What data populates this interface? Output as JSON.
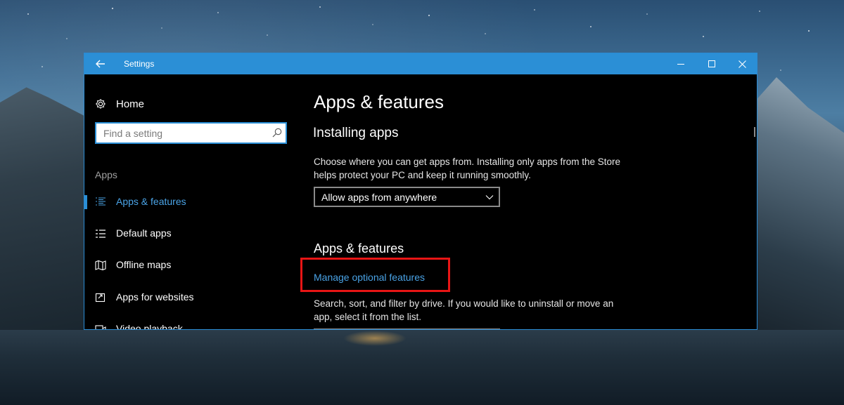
{
  "window": {
    "title": "Settings"
  },
  "sidebar": {
    "home_label": "Home",
    "search_placeholder": "Find a setting",
    "section_label": "Apps",
    "items": [
      {
        "label": "Apps & features",
        "icon": "list-icon",
        "active": true
      },
      {
        "label": "Default apps",
        "icon": "default-apps-icon",
        "active": false
      },
      {
        "label": "Offline maps",
        "icon": "map-icon",
        "active": false
      },
      {
        "label": "Apps for websites",
        "icon": "open-external-icon",
        "active": false
      },
      {
        "label": "Video playback",
        "icon": "video-icon",
        "active": false
      }
    ]
  },
  "main": {
    "page_title": "Apps & features",
    "installing_title": "Installing apps",
    "installing_desc": "Choose where you can get apps from. Installing only apps from the Store helps protect your PC and keep it running smoothly.",
    "install_source_value": "Allow apps from anywhere",
    "apps_title": "Apps & features",
    "manage_link": "Manage optional features",
    "apps_desc": "Search, sort, and filter by drive. If you would like to uninstall or move an app, select it from the list."
  },
  "colors": {
    "accent": "#2b8fd6",
    "link": "#4aa3e6",
    "highlight": "#e81515",
    "background": "#000000"
  }
}
